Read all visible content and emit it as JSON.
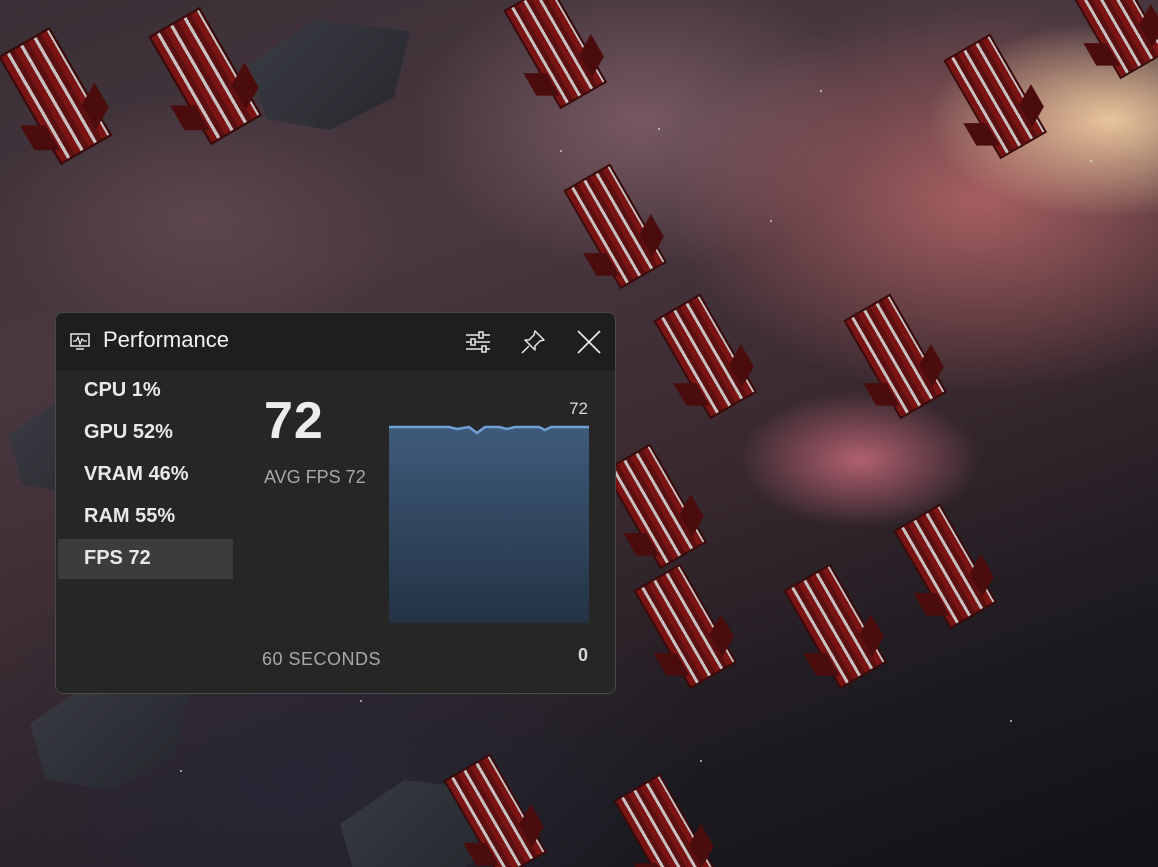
{
  "widget": {
    "title": "Performance",
    "title_icon": "performance-monitor-icon",
    "buttons": {
      "settings_icon": "sliders-icon",
      "pin_icon": "pin-icon",
      "close_icon": "close-icon"
    }
  },
  "metrics": [
    {
      "label": "CPU   1%",
      "selected": false
    },
    {
      "label": "GPU  52%",
      "selected": false
    },
    {
      "label": "VRAM  46%",
      "selected": false
    },
    {
      "label": "RAM  55%",
      "selected": false
    },
    {
      "label": "FPS   72",
      "selected": true
    }
  ],
  "detail": {
    "value": "72",
    "avg_label": "AVG FPS  72",
    "time_window": "60 SECONDS",
    "graph_max": "72",
    "graph_min": "0",
    "line_color": "#6fa0d6",
    "fill_top": "#3e5a7a",
    "fill_bottom": "#243344"
  }
}
